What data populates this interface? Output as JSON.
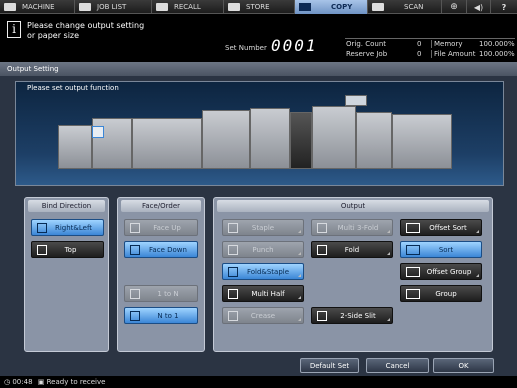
{
  "tabs": [
    {
      "label": "MACHINE",
      "active": false
    },
    {
      "label": "JOB LIST",
      "active": false
    },
    {
      "label": "RECALL",
      "active": false
    },
    {
      "label": "STORE",
      "active": false
    },
    {
      "label": "COPY",
      "active": true
    },
    {
      "label": "SCAN",
      "active": false
    }
  ],
  "message": {
    "line1": "Please change output setting",
    "line2": "or paper size",
    "icon": "info-icon"
  },
  "set_number": {
    "label": "Set Number",
    "value": "0001"
  },
  "status": {
    "orig_count_label": "Orig. Count",
    "orig_count": "0",
    "memory_label": "Memory",
    "memory": "100.000%",
    "reserve_job_label": "Reserve Job",
    "reserve_job": "0",
    "file_amount_label": "File Amount",
    "file_amount": "100.000%"
  },
  "window_title": "Output Setting",
  "instruction": "Please set output function",
  "bind_direction": {
    "header": "Bind Direction",
    "right_left": "Right&Left",
    "top": "Top"
  },
  "face_order": {
    "header": "Face/Order",
    "face_up": "Face Up",
    "face_down": "Face Down",
    "one_to_n": "1 to N",
    "n_to_one": "N to 1"
  },
  "output": {
    "header": "Output",
    "staple": "Staple",
    "punch": "Punch",
    "fold_staple": "Fold&Staple",
    "multi_half": "Multi Half",
    "crease": "Crease",
    "multi_3fold": "Multi 3-Fold",
    "fold": "Fold",
    "two_side_slit": "2-Side Slit",
    "offset_sort": "Offset Sort",
    "sort": "Sort",
    "offset_group": "Offset Group",
    "group": "Group"
  },
  "footer": {
    "default_set": "Default Set",
    "cancel": "Cancel",
    "ok": "OK"
  },
  "statusbar": {
    "time": "00:48",
    "status": "Ready to receive"
  },
  "colors": {
    "selected": "#3b86d6",
    "window_bg": "#2b3443",
    "panel": "#1d3f66"
  }
}
